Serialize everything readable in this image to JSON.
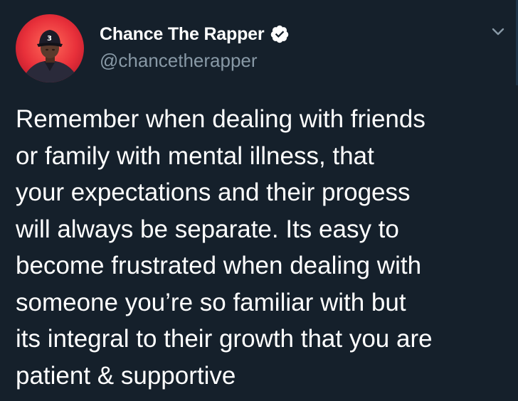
{
  "tweet": {
    "author": {
      "display_name": "Chance The Rapper",
      "handle": "@chancetherapper",
      "verified": true,
      "avatar_cap_number": "3"
    },
    "text_lines": [
      "Remember when dealing with friends",
      "or family with mental illness, that",
      "your expectations and their progess",
      "will always be separate. Its easy to",
      "become frustrated when dealing with",
      "someone you’re so familiar with but",
      "its integral to their growth that you are",
      "patient & supportive"
    ],
    "icons": {
      "verified": "verified-badge-icon",
      "menu": "chevron-down-icon"
    }
  },
  "colors": {
    "background": "#15202b",
    "text_primary": "#ffffff",
    "text_secondary": "#8899a6",
    "avatar_red": "#e8303a"
  }
}
